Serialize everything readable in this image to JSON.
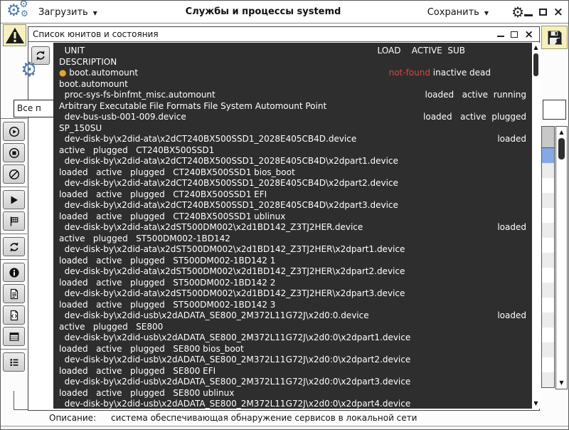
{
  "window": {
    "title": "Службы и процессы systemd"
  },
  "toolbar": {
    "load_label": "Загрузить",
    "save_label": "Сохранить"
  },
  "filter": {
    "combobox_value": "Все п"
  },
  "sidebar": {
    "buttons": [
      {
        "sep": true
      },
      {
        "name": "circled-play-button",
        "icon": "play-circle-icon"
      },
      {
        "name": "circled-stop-button",
        "icon": "stop-circle-icon"
      },
      {
        "name": "ban-button",
        "icon": "ban-icon"
      },
      {
        "sep": true
      },
      {
        "name": "play-button",
        "icon": "play-icon"
      },
      {
        "name": "flag-button",
        "icon": "flag-icon"
      },
      {
        "sep": true
      },
      {
        "name": "refresh-button",
        "icon": "refresh-icon"
      },
      {
        "sep": true
      },
      {
        "name": "info-button",
        "icon": "info-icon"
      },
      {
        "name": "document-button",
        "icon": "document-icon"
      },
      {
        "name": "code-file-button",
        "icon": "code-file-icon"
      },
      {
        "name": "table-button",
        "icon": "table-icon"
      },
      {
        "sep": true
      },
      {
        "name": "list-button",
        "icon": "list-icon"
      }
    ]
  },
  "dialog": {
    "title": "Список юнитов и состояния",
    "terminal": {
      "lines": [
        {
          "l": "  UNIT",
          "r": "LOAD    ACTIVE  SUB",
          "rm": 86
        },
        {
          "l": "DESCRIPTION"
        },
        {
          "l": [
            {
              "t": "● ",
              "c": "dot"
            },
            {
              "t": "boot.automount"
            }
          ],
          "r": [
            {
              "t": "not-found",
              "c": "red"
            },
            {
              "t": " inactive dead"
            }
          ],
          "rm": 50
        },
        {
          "l": "boot.automount"
        },
        {
          "l": "  proc-sys-fs-binfmt_misc.automount",
          "r": "loaded   active  running"
        },
        {
          "l": "Arbitrary Executable File Formats File System Automount Point"
        },
        {
          "l": "  dev-bus-usb-001-009.device",
          "r": "loaded   active  plugged"
        },
        {
          "l": "SP_150SU"
        },
        {
          "l": "  dev-disk-by\\x2did-ata\\x2dCT240BX500SSD1_2028E405CB4D.device",
          "r": "loaded"
        },
        {
          "l": "active   plugged   CT240BX500SSD1"
        },
        {
          "l": "  dev-disk-by\\x2did-ata\\x2dCT240BX500SSD1_2028E405CB4D\\x2dpart1.device"
        },
        {
          "l": "loaded   active   plugged   CT240BX500SSD1 bios_boot"
        },
        {
          "l": "  dev-disk-by\\x2did-ata\\x2dCT240BX500SSD1_2028E405CB4D\\x2dpart2.device"
        },
        {
          "l": "loaded   active   plugged   CT240BX500SSD1 EFI"
        },
        {
          "l": "  dev-disk-by\\x2did-ata\\x2dCT240BX500SSD1_2028E405CB4D\\x2dpart3.device"
        },
        {
          "l": "loaded   active   plugged   CT240BX500SSD1 ublinux"
        },
        {
          "l": "  dev-disk-by\\x2did-ata\\x2dST500DM002\\x2d1BD142_Z3TJ2HER.device",
          "r": "loaded"
        },
        {
          "l": "active   plugged   ST500DM002-1BD142"
        },
        {
          "l": "  dev-disk-by\\x2did-ata\\x2dST500DM002\\x2d1BD142_Z3TJ2HER\\x2dpart1.device"
        },
        {
          "l": "loaded   active   plugged   ST500DM002-1BD142 1"
        },
        {
          "l": "  dev-disk-by\\x2did-ata\\x2dST500DM002\\x2d1BD142_Z3TJ2HER\\x2dpart2.device"
        },
        {
          "l": "loaded   active   plugged   ST500DM002-1BD142 2"
        },
        {
          "l": "  dev-disk-by\\x2did-ata\\x2dST500DM002\\x2d1BD142_Z3TJ2HER\\x2dpart3.device"
        },
        {
          "l": "loaded   active   plugged   ST500DM002-1BD142 3"
        },
        {
          "l": "  dev-disk-by\\x2did-usb\\x2dADATA_SE800_2M372L11G72J\\x2d0:0.device",
          "r": "loaded"
        },
        {
          "l": "active   plugged   SE800"
        },
        {
          "l": "  dev-disk-by\\x2did-usb\\x2dADATA_SE800_2M372L11G72J\\x2d0:0\\x2dpart1.device"
        },
        {
          "l": "loaded   active   plugged   SE800 bios_boot"
        },
        {
          "l": "  dev-disk-by\\x2did-usb\\x2dADATA_SE800_2M372L11G72J\\x2d0:0\\x2dpart2.device"
        },
        {
          "l": "loaded   active   plugged   SE800 EFI"
        },
        {
          "l": "  dev-disk-by\\x2did-usb\\x2dADATA_SE800_2M372L11G72J\\x2d0:0\\x2dpart3.device"
        },
        {
          "l": "loaded   active   plugged   SE800 ublinux"
        },
        {
          "l": "  dev-disk-by\\x2did-usb\\x2dADATA_SE800_2M372L11G72J\\x2d0:0\\x2dpart4.device"
        }
      ]
    }
  },
  "statusbar": {
    "label": "Описание:",
    "value": "система обеспечивающая обнаружение сервисов в локальной сети"
  },
  "colors": {
    "accent_blue": "#4d7ba9",
    "selection_blue": "#84a9e6",
    "terminal_bg": "#2e2e2e",
    "terminal_fg": "#ffffff",
    "red": "#d14b42",
    "dot": "#dfa928",
    "pale_yellow": "#f6f0bc"
  }
}
